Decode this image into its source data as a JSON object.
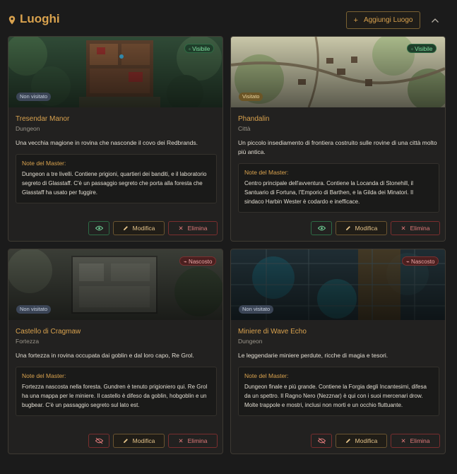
{
  "header": {
    "title": "Luoghi",
    "add_button": "Aggiungi Luogo",
    "icons": {
      "title": "map-pin-icon",
      "add": "plus-icon",
      "collapse": "chevron-up-icon"
    }
  },
  "colors": {
    "accent": "#d9a24e",
    "visible": "#7fe0a0",
    "hidden": "#f0a8a8",
    "danger": "#e07a7a"
  },
  "common": {
    "notes_title": "Note del Master:",
    "edit_label": "Modifica",
    "delete_label": "Elimina"
  },
  "locations": [
    {
      "name": "Tresendar Manor",
      "type": "Dungeon",
      "visibility": "Visibile",
      "visit_status": "Non visitato",
      "description": "Una vecchia magione in rovina che nasconde il covo dei Redbrands.",
      "notes": "Dungeon a tre livelli. Contiene prigioni, quartieri dei banditi, e il laboratorio segreto di Glasstaff. C'è un passaggio segreto che porta alla foresta che Glasstaff ha usato per fuggire."
    },
    {
      "name": "Phandalin",
      "type": "Città",
      "visibility": "Visibile",
      "visit_status": "Visitato",
      "description": "Un piccolo insediamento di frontiera costruito sulle rovine di una città molto più antica.",
      "notes": "Centro principale dell'avventura. Contiene la Locanda di Stonehill, il Santuario di Fortuna, l'Emporio di Barthen, e la Gilda dei Minatori. Il sindaco Harbin Wester è codardo e inefficace."
    },
    {
      "name": "Castello di Cragmaw",
      "type": "Fortezza",
      "visibility": "Nascosto",
      "visit_status": "Non visitato",
      "description": "Una fortezza in rovina occupata dai goblin e dal loro capo, Re Grol.",
      "notes": "Fortezza nascosta nella foresta. Gundren è tenuto prigioniero qui. Re Grol ha una mappa per le miniere. Il castello è difeso da goblin, hobgoblin e un bugbear. C'è un passaggio segreto sul lato est."
    },
    {
      "name": "Miniere di Wave Echo",
      "type": "Dungeon",
      "visibility": "Nascosto",
      "visit_status": "Non visitato",
      "description": "Le leggendarie miniere perdute, ricche di magia e tesori.",
      "notes": "Dungeon finale e più grande. Contiene la Forgia degli Incantesimi, difesa da un spettro. Il Ragno Nero (Nezznar) è qui con i suoi mercenari drow. Molte trappole e mostri, inclusi non morti e un occhio fluttuante."
    }
  ]
}
